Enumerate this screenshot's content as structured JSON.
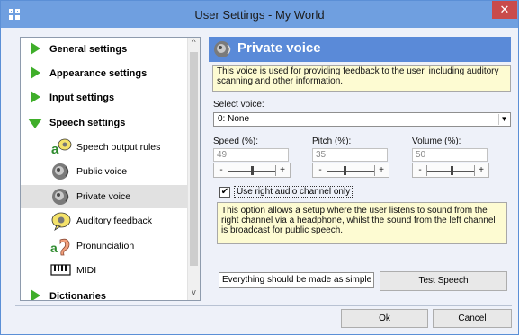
{
  "window": {
    "title": "User Settings - My World",
    "close_glyph": "✕",
    "app_icon": "grid-app-icon"
  },
  "tree": {
    "items": [
      {
        "label": "General settings",
        "kind": "category",
        "expanded": false,
        "icon": "green-arrow-right-icon"
      },
      {
        "label": "Appearance settings",
        "kind": "category",
        "expanded": false,
        "icon": "green-arrow-right-icon"
      },
      {
        "label": "Input settings",
        "kind": "category",
        "expanded": false,
        "icon": "green-arrow-right-icon"
      },
      {
        "label": "Speech settings",
        "kind": "category",
        "expanded": true,
        "icon": "green-arrow-down-icon"
      },
      {
        "label": "Speech output rules",
        "kind": "sub",
        "icon": "speech-rules-icon"
      },
      {
        "label": "Public voice",
        "kind": "sub",
        "icon": "speaker-icon"
      },
      {
        "label": "Private voice",
        "kind": "sub",
        "icon": "speaker-icon",
        "selected": true
      },
      {
        "label": "Auditory feedback",
        "kind": "sub",
        "icon": "speech-bubble-icon"
      },
      {
        "label": "Pronunciation",
        "kind": "sub",
        "icon": "ear-icon"
      },
      {
        "label": "MIDI",
        "kind": "sub",
        "icon": "piano-keys-icon"
      },
      {
        "label": "Dictionaries",
        "kind": "category",
        "expanded": false,
        "icon": "green-arrow-right-icon"
      }
    ]
  },
  "panel": {
    "title": "Private voice",
    "description": "This voice is used for providing feedback to the user, including auditory scanning and other information.",
    "select_voice_label": "Select voice:",
    "select_voice_value": "0: None",
    "speed_label": "Speed (%):",
    "speed_value": "49",
    "pitch_label": "Pitch (%):",
    "pitch_value": "35",
    "volume_label": "Volume (%):",
    "volume_value": "50",
    "slider_minus": "-",
    "slider_plus": "+",
    "right_channel_checked": true,
    "check_glyph": "✔",
    "right_channel_label": "Use right audio channel only",
    "channel_description": "This option allows a setup where the user listens to sound from the right channel via a headphone, whilst the sound from the left channel is broadcast for public speech.",
    "test_text_value": "Everything should be made as simple as p",
    "test_speech_label": "Test Speech"
  },
  "footer": {
    "ok_label": "Ok",
    "cancel_label": "Cancel"
  },
  "colors": {
    "titlebar": "#6f9fe0",
    "header_bar": "#5a8ad8",
    "accent_green": "#3fae2a",
    "info_yellow": "#fdfbd2"
  }
}
